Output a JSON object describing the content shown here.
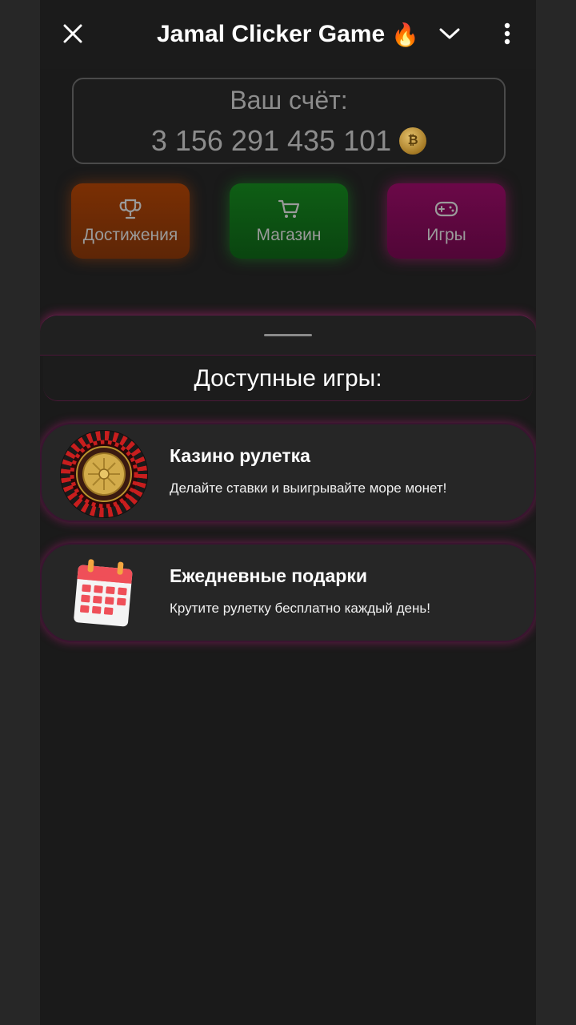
{
  "header": {
    "title": "Jamal Clicker Game",
    "title_emoji": "🔥",
    "close_icon": "close-icon",
    "chevron_icon": "chevron-down-icon",
    "more_icon": "more-vertical-icon"
  },
  "score": {
    "label": "Ваш счёт:",
    "value": "3 156 291 435 101",
    "coin_icon": "coin-icon"
  },
  "nav": {
    "achievements": {
      "label": "Достижения",
      "icon": "trophy-icon",
      "color": "#7a2f04"
    },
    "shop": {
      "label": "Магазин",
      "icon": "cart-icon",
      "color": "#0f5e15"
    },
    "games": {
      "label": "Игры",
      "icon": "gamepad-icon",
      "color": "#6b0848"
    }
  },
  "sheet": {
    "section_title": "Доступные игры:",
    "games": [
      {
        "title": "Казино рулетка",
        "description": "Делайте ставки и выигрывайте море монет!",
        "icon": "roulette-icon"
      },
      {
        "title": "Ежедневные подарки",
        "description": "Крутите рулетку бесплатно каждый день!",
        "icon": "calendar-icon"
      }
    ]
  },
  "colors": {
    "background": "#1a1a1a",
    "accent_glow": "#e61e96"
  }
}
